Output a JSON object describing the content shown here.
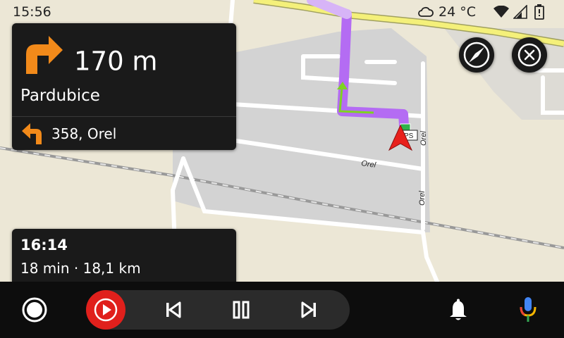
{
  "status_bar": {
    "time": "15:56",
    "temperature": "24 °C",
    "icons": [
      "cloud-icon",
      "wifi-icon",
      "cellular-signal-icon",
      "battery-icon"
    ]
  },
  "map": {
    "street_labels": [
      "Orel",
      "Orel",
      "Orel"
    ],
    "poi_label": "PS",
    "poi_icon": "gas-station-icon",
    "route_color": "#b46cf3",
    "upcoming_route_color": "#7ed321",
    "position_marker_color": "#e8201c"
  },
  "turn_card": {
    "distance": "170 m",
    "street": "Pardubice",
    "next_turn": "358, Orel",
    "turn_icon": "turn-right-arrow-icon",
    "next_turn_icon": "turn-left-arrow-icon",
    "accent_color": "#f28a1a"
  },
  "eta_card": {
    "arrival_time": "16:14",
    "trip_info": "18 min · 18,1 km"
  },
  "map_controls": {
    "compass_icon": "compass-icon",
    "close_icon": "close-circle-icon"
  },
  "bottom_bar": {
    "icons": [
      "home-icon",
      "youtube-music-icon",
      "skip-previous-icon",
      "pause-icon",
      "skip-next-icon",
      "notifications-bell-icon",
      "microphone-icon"
    ],
    "media_accent_color": "#e0201c"
  }
}
